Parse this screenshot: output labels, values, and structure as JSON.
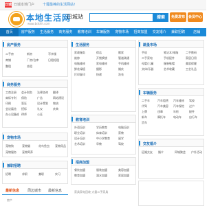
{
  "topbar": {
    "badge": "日城",
    "text": "日城本地门户",
    "hint": "十堰最棒的生活网站！"
  },
  "header": {
    "logo_text": "本地生活网",
    "logo_url": "www.bdshh.com",
    "city": "日城站",
    "search_label": "搜索",
    "post_label": "免费发布",
    "member_label": "会员中心"
  },
  "nav": [
    "首页",
    "房产服务",
    "生活服务",
    "商务服务",
    "教育培训",
    "车辆服务",
    "宠物市场",
    "招商加盟",
    "交友婚介",
    "兼职招聘",
    "店铺"
  ],
  "boxes": {
    "house": {
      "title": "房产服务",
      "items": [
        "二手房",
        "新房",
        "写字楼",
        "商铺",
        "厂房/仓库",
        "日租短租",
        "整租",
        "合租"
      ]
    },
    "life": {
      "title": "生活服务",
      "items": [
        "家政服务",
        "保洁",
        "搬家",
        "维修",
        "开锁换锁",
        "管道疏通",
        "电脑维修",
        "家电维修",
        "手机维修",
        "鲜花绿植",
        "摄影",
        "婚庆",
        "打印复印",
        "快递",
        "洗衣"
      ]
    },
    "used": {
      "title": "跳蚤市场",
      "items": [
        "手机",
        "笔记本/电脑",
        "二手数码",
        "二手家电",
        "手机配件",
        "家居日用",
        "母婴/儿童",
        "服装鞋帽",
        "美容保健",
        "文体/乐器",
        "艺术收藏",
        "工艺礼品"
      ]
    },
    "biz": {
      "title": "商务服务",
      "items": [
        "工商注册",
        "会计财务",
        "法律咨询",
        "翻译",
        "商标专利",
        "保险",
        "广告",
        "网站建设",
        "印刷",
        "签证",
        "设计策划",
        "物流",
        "会议展览",
        "招标",
        "礼仪",
        "庆典",
        "办公设备维修",
        "律师",
        "公证"
      ]
    },
    "edu": {
      "title": "教育培训",
      "items": [
        "外语培训",
        "学历教育",
        "电脑培训",
        "职业培训",
        "体育培训",
        "家教",
        "设计培训",
        "中小学教育",
        "留学",
        "艺术培训",
        "早教",
        "驾校",
        "会计培训",
        "企业管理",
        "技能培训"
      ]
    },
    "car": {
      "title": "车辆服务",
      "items": [
        "二手车",
        "汽车租赁",
        "汽车维修",
        "驾校",
        "代驾",
        "汽车美容",
        "汽车保险",
        "过户",
        "上牌",
        "违章",
        "年检",
        "配件",
        "新车",
        "摩托车",
        "电动车",
        "自行车",
        "货车"
      ]
    },
    "pet": {
      "title": "宠物市场",
      "items": [
        "宠物狗",
        "宠物猫",
        "花鸟鱼虫",
        "宠物用品",
        "宠物服务",
        "宠物寄养"
      ]
    },
    "join": {
      "title": "招商加盟",
      "items": [
        "餐饮加盟",
        "服装加盟",
        "美容加盟",
        "教育加盟",
        "酒水加盟",
        "家居加盟",
        "建材加盟",
        "礼品加盟",
        "汽车加盟",
        "环保加盟",
        "机械加盟",
        "服务加盟",
        "其它加盟",
        "项目加盟",
        "农业加盟"
      ]
    },
    "dating": {
      "title": "交友婚介",
      "items": [
        "征婚交友",
        "婚介",
        "同城聚会",
        "户外活动"
      ]
    },
    "job": {
      "title": "兼职招聘",
      "items": [
        "招聘",
        "求职",
        "兼职",
        "实习"
      ]
    }
  },
  "bottom": {
    "tab_a": "最新信息",
    "tab_b": "周边城市",
    "tab_c": "最新信息",
    "line_a": "房产",
    "line_b": "家具家电回收 大量二手家具"
  }
}
